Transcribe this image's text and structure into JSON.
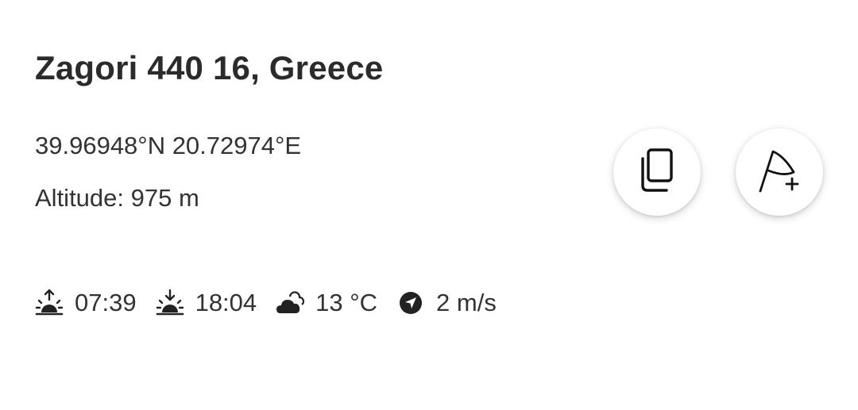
{
  "location": {
    "title": "Zagori 440 16, Greece",
    "coordinates": "39.96948°N 20.72974°E",
    "altitude_label": "Altitude:",
    "altitude_value": "975 m"
  },
  "actions": {
    "copy_icon": "copy-icon",
    "add_waypoint_icon": "add-waypoint-flag-icon"
  },
  "conditions": {
    "sunrise": {
      "icon": "sunrise-icon",
      "value": "07:39"
    },
    "sunset": {
      "icon": "sunset-icon",
      "value": "18:04"
    },
    "temperature": {
      "icon": "partly-cloudy-icon",
      "value": "13 °C"
    },
    "wind": {
      "icon": "wind-direction-icon",
      "value": "2 m/s"
    }
  },
  "colors": {
    "text": "#2b2b2b",
    "background": "#ffffff"
  }
}
